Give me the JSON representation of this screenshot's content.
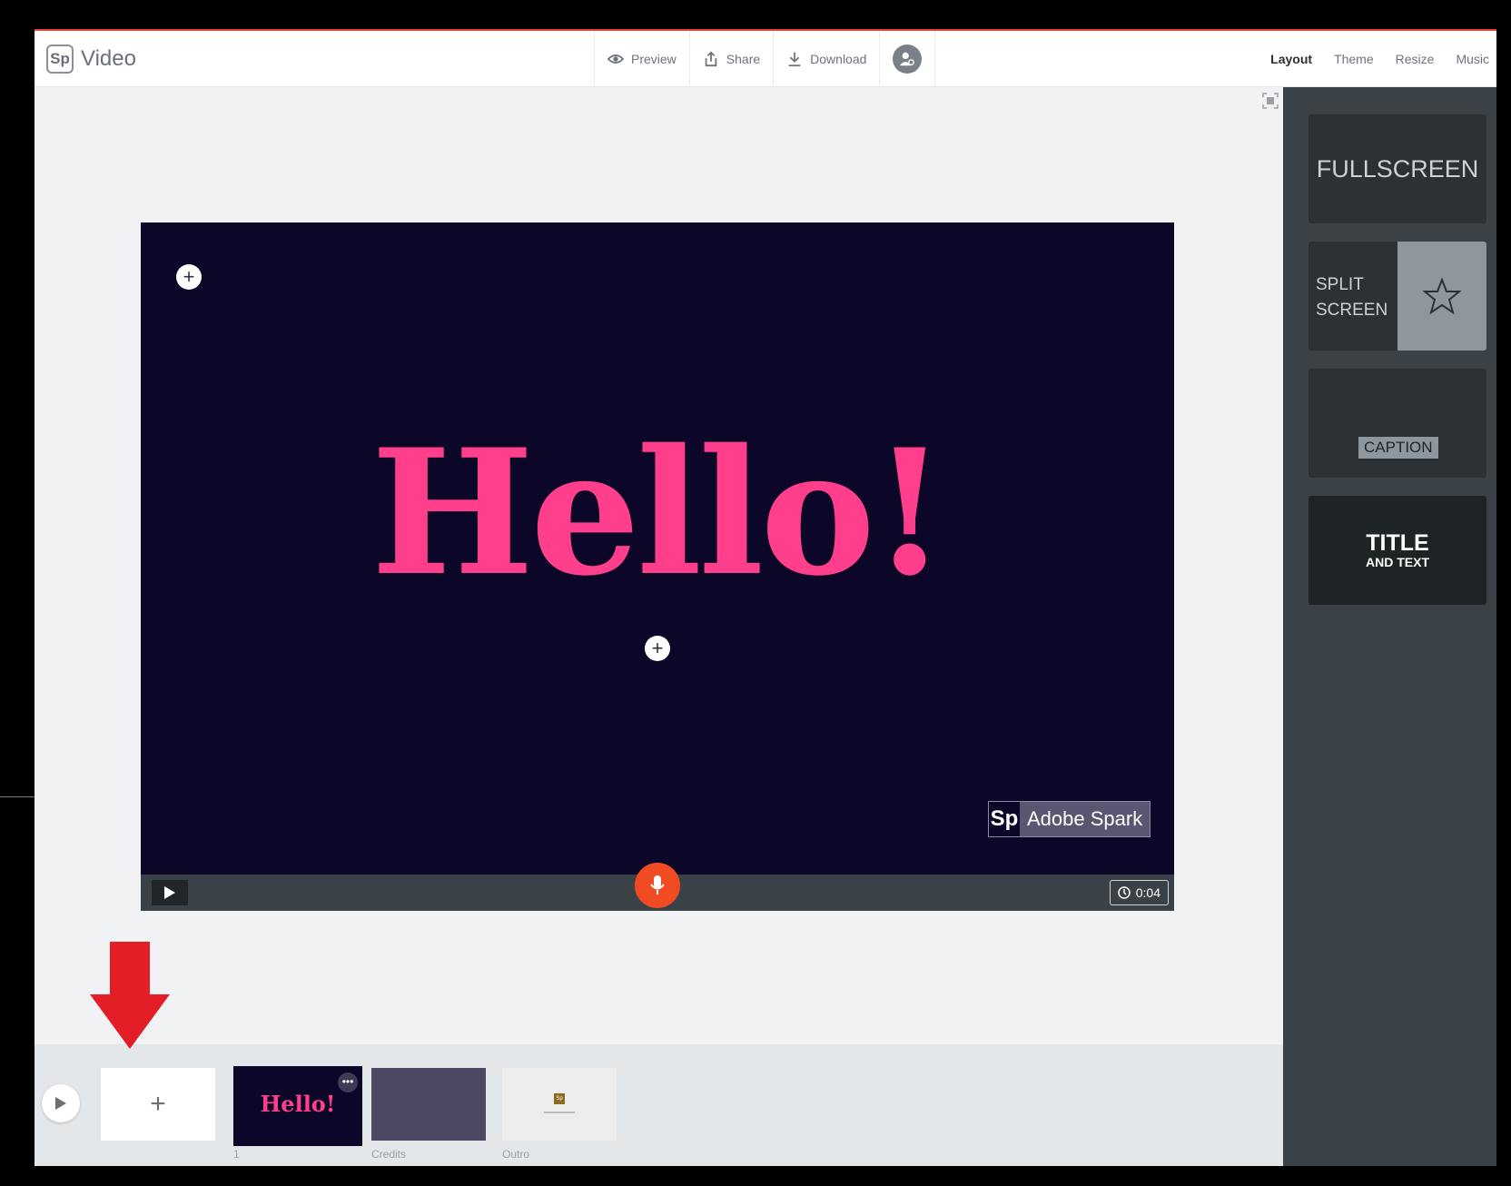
{
  "app": {
    "logo": "Sp",
    "name": "Video"
  },
  "toolbar": {
    "preview": "Preview",
    "share": "Share",
    "download": "Download"
  },
  "tabs": [
    {
      "label": "Layout",
      "active": true
    },
    {
      "label": "Theme"
    },
    {
      "label": "Resize"
    },
    {
      "label": "Music"
    }
  ],
  "stage": {
    "headline": "Hello!",
    "badge_logo": "Sp",
    "badge_name": "Adobe Spark",
    "duration": "0:04",
    "bg_color": "#0c0628",
    "text_color": "#ff3e8c"
  },
  "layouts": {
    "fullscreen": "FULLSCREEN",
    "split_line1": "SPLIT",
    "split_line2": "SCREEN",
    "caption": "CAPTION",
    "title_main": "TITLE",
    "title_sub": "AND TEXT"
  },
  "timeline": {
    "add": "+",
    "slide1_text": "Hello!",
    "slide1_more": "•••",
    "slide1_num": "1",
    "slide2_label": "Credits",
    "slide3_label": "Outro",
    "mini_logo": "Sp"
  },
  "colors": {
    "accent": "#e8443a",
    "mic": "#f04b23",
    "sidebar": "#3a4247"
  },
  "icons": [
    "eye-icon",
    "share-icon",
    "download-icon",
    "user-icon",
    "plus-icon",
    "play-icon",
    "mic-icon",
    "clock-icon",
    "star-icon",
    "fit-screen-icon",
    "arrow-down-icon"
  ]
}
